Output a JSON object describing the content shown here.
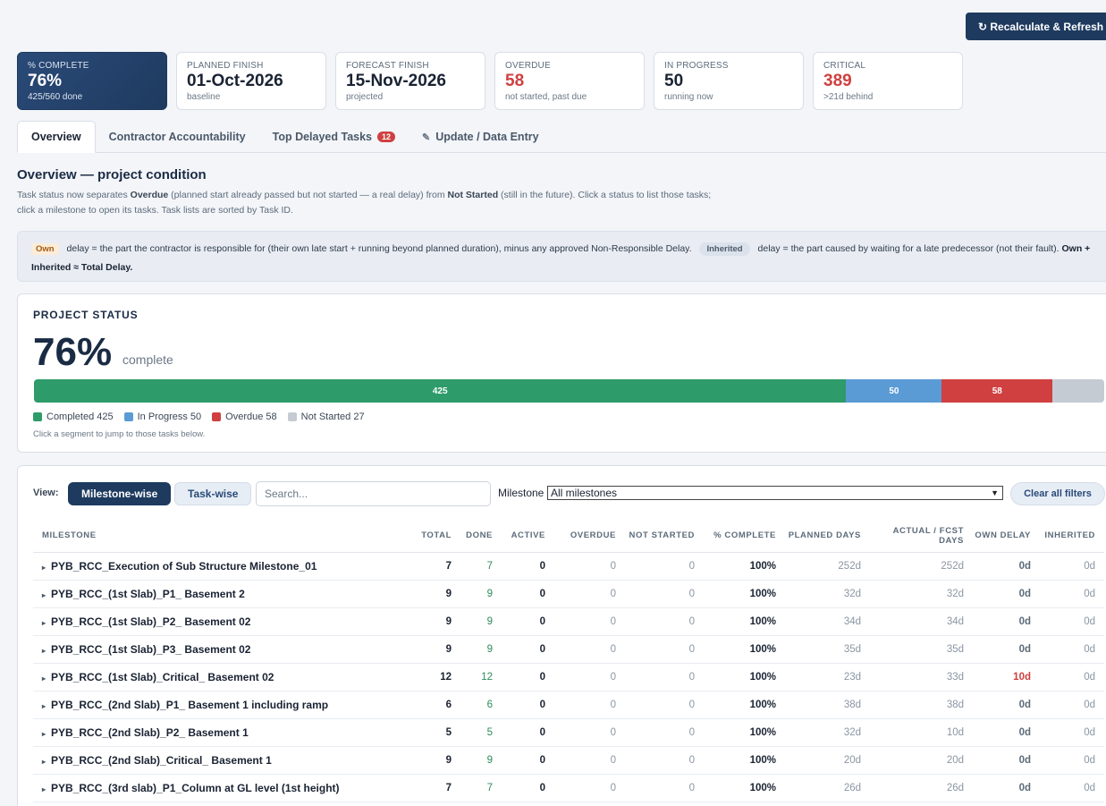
{
  "toolbar": {
    "refresh_label": "↻ Recalculate & Refresh"
  },
  "kpis": [
    {
      "label": "% COMPLETE",
      "value": "76%",
      "sub": "425/560 done"
    },
    {
      "label": "PLANNED FINISH",
      "value": "01-Oct-2026",
      "sub": "baseline"
    },
    {
      "label": "FORECAST FINISH",
      "value": "15-Nov-2026",
      "sub": "projected"
    },
    {
      "label": "OVERDUE",
      "value": "58",
      "sub": "not started, past due"
    },
    {
      "label": "IN PROGRESS",
      "value": "50",
      "sub": "running now"
    },
    {
      "label": "CRITICAL",
      "value": "389",
      "sub": ">21d behind"
    }
  ],
  "tabs": [
    {
      "label": "Overview"
    },
    {
      "label": "Contractor Accountability"
    },
    {
      "label": "Top Delayed Tasks",
      "badge": "12"
    },
    {
      "label": "Update / Data Entry"
    }
  ],
  "overview": {
    "title": "Overview — project condition",
    "desc_1": "Task status now separates ",
    "desc_overdue": "Overdue",
    "desc_2": " (planned start already passed but not started — a real delay) from ",
    "desc_notstarted": "Not Started",
    "desc_3": " (still in the future). Click a status to list those tasks;",
    "desc_4": "click a milestone to open its tasks. Task lists are sorted by Task ID."
  },
  "legend_note": {
    "own_chip": "Own",
    "own_text": "delay = the part the contractor is responsible for (their own late start + running beyond planned duration), minus any approved Non-Responsible Delay.",
    "inherited_chip": "Inherited",
    "inherited_text": "delay = the part caused by waiting for a late predecessor (not their fault).",
    "formula": "Own + Inherited ≈ Total Delay."
  },
  "project_status": {
    "title": "PROJECT STATUS",
    "percent": "76%",
    "complete_word": "complete",
    "segments": [
      {
        "label": "Completed",
        "value": 425,
        "bar_label": "425",
        "color": "#2e9b6a"
      },
      {
        "label": "In Progress",
        "value": 50,
        "bar_label": "50",
        "color": "#5b9bd5"
      },
      {
        "label": "Overdue",
        "value": 58,
        "bar_label": "58",
        "color": "#d04040"
      },
      {
        "label": "Not Started",
        "value": 27,
        "bar_label": "",
        "color": "#c5cbd3"
      }
    ],
    "legend": [
      "Completed 425",
      "In Progress 50",
      "Overdue 58",
      "Not Started 27"
    ],
    "hint": "Click a segment to jump to those tasks below."
  },
  "table_controls": {
    "view_label": "View:",
    "milestone_btn": "Milestone-wise",
    "task_btn": "Task-wise",
    "search_placeholder": "Search...",
    "milestone_label": "Milestone",
    "milestone_value": "All milestones",
    "clear_label": "Clear all filters"
  },
  "columns": [
    "MILESTONE",
    "TOTAL",
    "DONE",
    "ACTIVE",
    "OVERDUE",
    "NOT STARTED",
    "% COMPLETE",
    "PLANNED DAYS",
    "ACTUAL / FCST DAYS",
    "OWN DELAY",
    "INHERITED"
  ],
  "rows": [
    {
      "name": "PYB_RCC_Execution of Sub Structure Milestone_01",
      "total": "7",
      "done": "7",
      "active": "0",
      "overdue": "0",
      "not_started": "0",
      "pct": "100%",
      "planned": "252d",
      "actual": "252d",
      "own": "0d",
      "inherited": "0d"
    },
    {
      "name": "PYB_RCC_(1st Slab)_P1_ Basement 2",
      "total": "9",
      "done": "9",
      "active": "0",
      "overdue": "0",
      "not_started": "0",
      "pct": "100%",
      "planned": "32d",
      "actual": "32d",
      "own": "0d",
      "inherited": "0d"
    },
    {
      "name": "PYB_RCC_(1st Slab)_P2_ Basement 02",
      "total": "9",
      "done": "9",
      "active": "0",
      "overdue": "0",
      "not_started": "0",
      "pct": "100%",
      "planned": "34d",
      "actual": "34d",
      "own": "0d",
      "inherited": "0d"
    },
    {
      "name": "PYB_RCC_(1st Slab)_P3_ Basement 02",
      "total": "9",
      "done": "9",
      "active": "0",
      "overdue": "0",
      "not_started": "0",
      "pct": "100%",
      "planned": "35d",
      "actual": "35d",
      "own": "0d",
      "inherited": "0d"
    },
    {
      "name": "PYB_RCC_(1st Slab)_Critical_ Basement 02",
      "total": "12",
      "done": "12",
      "active": "0",
      "overdue": "0",
      "not_started": "0",
      "pct": "100%",
      "planned": "23d",
      "actual": "33d",
      "own": "10d",
      "inherited": "0d"
    },
    {
      "name": "PYB_RCC_(2nd Slab)_P1_ Basement 1 including ramp",
      "total": "6",
      "done": "6",
      "active": "0",
      "overdue": "0",
      "not_started": "0",
      "pct": "100%",
      "planned": "38d",
      "actual": "38d",
      "own": "0d",
      "inherited": "0d"
    },
    {
      "name": "PYB_RCC_(2nd Slab)_P2_ Basement 1",
      "total": "5",
      "done": "5",
      "active": "0",
      "overdue": "0",
      "not_started": "0",
      "pct": "100%",
      "planned": "32d",
      "actual": "10d",
      "own": "0d",
      "inherited": "0d"
    },
    {
      "name": "PYB_RCC_(2nd Slab)_Critical_ Basement 1",
      "total": "9",
      "done": "9",
      "active": "0",
      "overdue": "0",
      "not_started": "0",
      "pct": "100%",
      "planned": "20d",
      "actual": "20d",
      "own": "0d",
      "inherited": "0d"
    },
    {
      "name": "PYB_RCC_(3rd slab)_P1_Column at GL level (1st height)",
      "total": "7",
      "done": "7",
      "active": "0",
      "overdue": "0",
      "not_started": "0",
      "pct": "100%",
      "planned": "26d",
      "actual": "26d",
      "own": "0d",
      "inherited": "0d"
    }
  ]
}
